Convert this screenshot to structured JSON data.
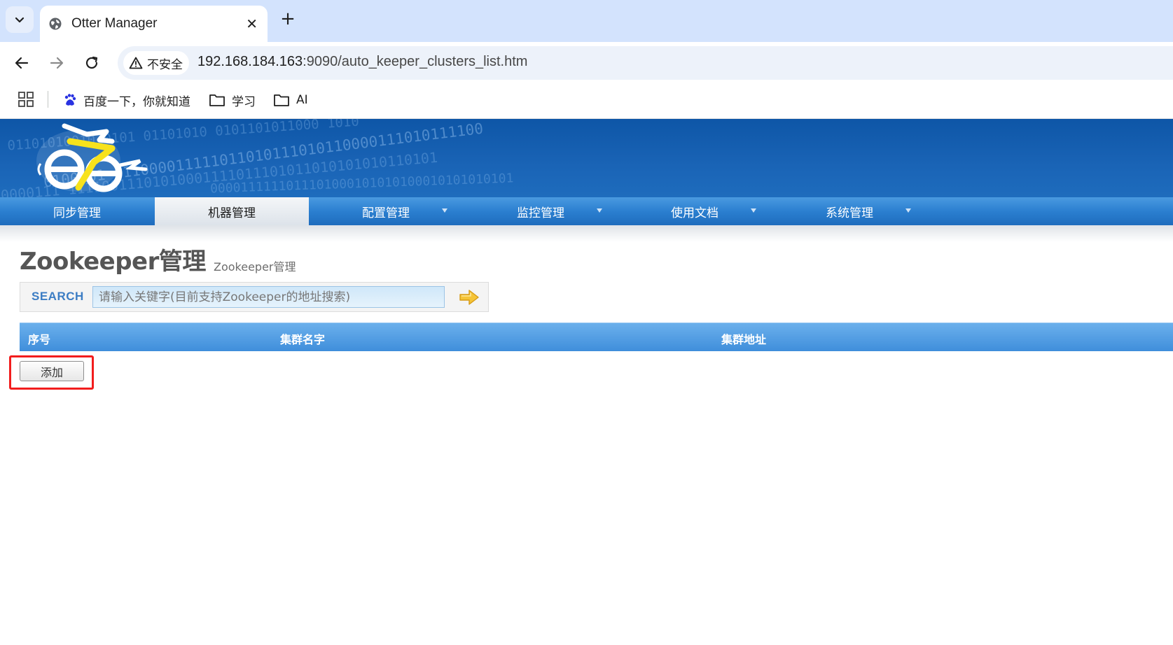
{
  "browser": {
    "tab_title": "Otter Manager",
    "tab_close": "✕",
    "new_tab": "+",
    "security_label": "不安全",
    "url_host": "192.168.184.163",
    "url_rest": ":9090/auto_keeper_clusters_list.htm",
    "bookmarks": [
      {
        "label": "百度一下，你就知道",
        "icon": "baidu-icon"
      },
      {
        "label": "学习",
        "icon": "folder-icon"
      },
      {
        "label": "AI",
        "icon": "folder-icon"
      }
    ]
  },
  "banner": {
    "binary_lines": [
      "0110101001010101 01101010 0101101011000 1010",
      "0100101 011000011111011010111010110000111010111100",
      "0000111 11110011101010001111011101011010101010110101",
      "0000111111011101000101010100010101010101"
    ]
  },
  "nav": {
    "items": [
      {
        "label": "同步管理",
        "active": false,
        "dropdown": false
      },
      {
        "label": "机器管理",
        "active": true,
        "dropdown": false
      },
      {
        "label": "配置管理",
        "active": false,
        "dropdown": true
      },
      {
        "label": "监控管理",
        "active": false,
        "dropdown": true
      },
      {
        "label": "使用文档",
        "active": false,
        "dropdown": true
      },
      {
        "label": "系统管理",
        "active": false,
        "dropdown": true
      }
    ]
  },
  "page": {
    "title": "Zookeeper管理",
    "subtitle": "Zookeeper管理"
  },
  "search": {
    "label": "SEARCH",
    "placeholder": "请输入关键字(目前支持Zookeeper的地址搜索)",
    "value": ""
  },
  "table": {
    "columns": [
      "序号",
      "集群名字",
      "集群地址"
    ],
    "rows": []
  },
  "actions": {
    "add_label": "添加"
  },
  "colors": {
    "banner_blue": "#1a64b6",
    "nav_blue": "#2b7fd0",
    "table_header_blue": "#4d9ae2",
    "highlight_red": "#f21d1d",
    "search_label": "#3c7dc4"
  }
}
